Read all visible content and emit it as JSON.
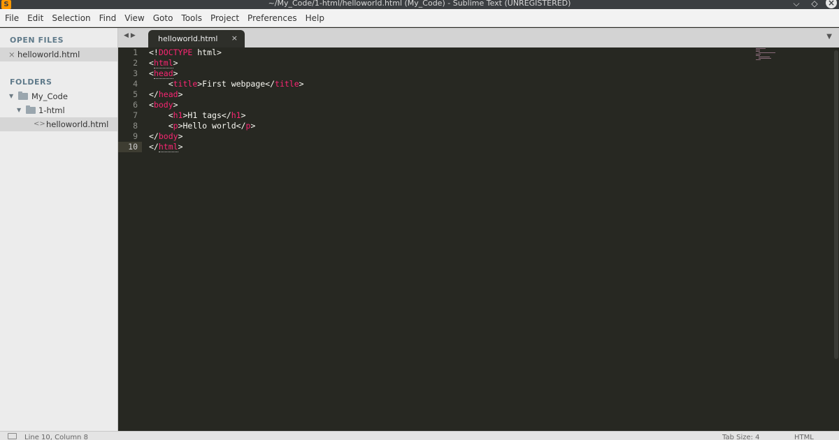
{
  "titlebar": {
    "app_icon": "S",
    "title": "~/My_Code/1-html/helloworld.html (My_Code) - Sublime Text (UNREGISTERED)",
    "minimize_icon": "chevron-down-icon",
    "minimize_glyph": "⌵",
    "maximize_icon": "diamond-icon",
    "maximize_glyph": "◇",
    "close_icon": "close-icon",
    "close_glyph": "×"
  },
  "menu": [
    "File",
    "Edit",
    "Selection",
    "Find",
    "View",
    "Goto",
    "Tools",
    "Project",
    "Preferences",
    "Help"
  ],
  "sidebar": {
    "open_files_heading": "OPEN FILES",
    "open_files": [
      {
        "close_glyph": "×",
        "name": "helloworld.html"
      }
    ],
    "folders_heading": "FOLDERS",
    "folders": [
      {
        "name": "My_Code",
        "expand_glyph": "▼"
      },
      {
        "name": "1-html",
        "expand_glyph": "▼"
      }
    ],
    "files": [
      {
        "name": "helloworld.html",
        "icon_glyph": "<>"
      }
    ]
  },
  "tabs": {
    "nav_glyph": "◀▶",
    "active_tab": "helloworld.html",
    "tab_close_glyph": "×",
    "dropdown_glyph": "▼"
  },
  "editor": {
    "line_numbers": [
      "1",
      "2",
      "3",
      "4",
      "5",
      "6",
      "7",
      "8",
      "9",
      "10"
    ],
    "active_line": 10
  },
  "status": {
    "position": "Line 10, Column 8",
    "tab_size": "Tab Size: 4",
    "syntax": "HTML"
  },
  "colors": {
    "editor_bg": "#272822",
    "tag": "#f92672",
    "text": "#f8f8f2",
    "accent": "#ff9800"
  }
}
